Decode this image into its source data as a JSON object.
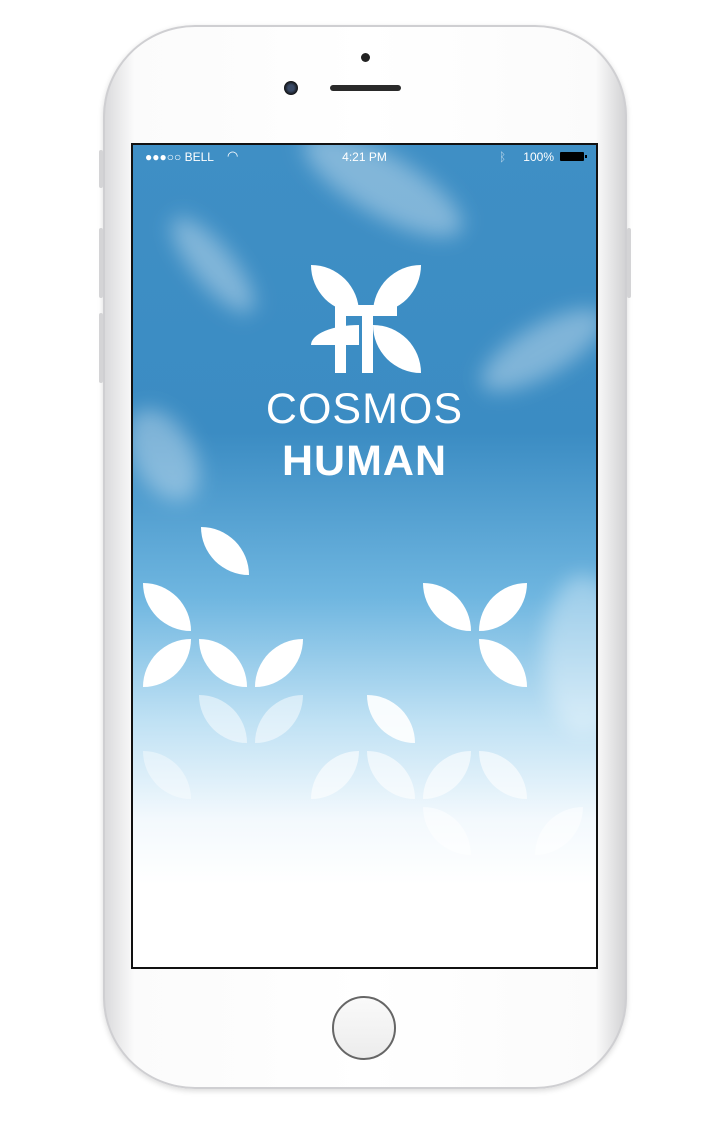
{
  "status_bar": {
    "carrier": "●●●○○ BELL",
    "wifi_icon": "wifi-icon",
    "time": "4:21 PM",
    "bluetooth_icon": "bluetooth-icon",
    "battery": "100%"
  },
  "app": {
    "name_line1": "COSMOS",
    "name_line2": "HUMAN",
    "logo_text": "COSMOS HUMAN"
  },
  "colors": {
    "sky": "#3f8fc5",
    "logo": "#ffffff"
  }
}
